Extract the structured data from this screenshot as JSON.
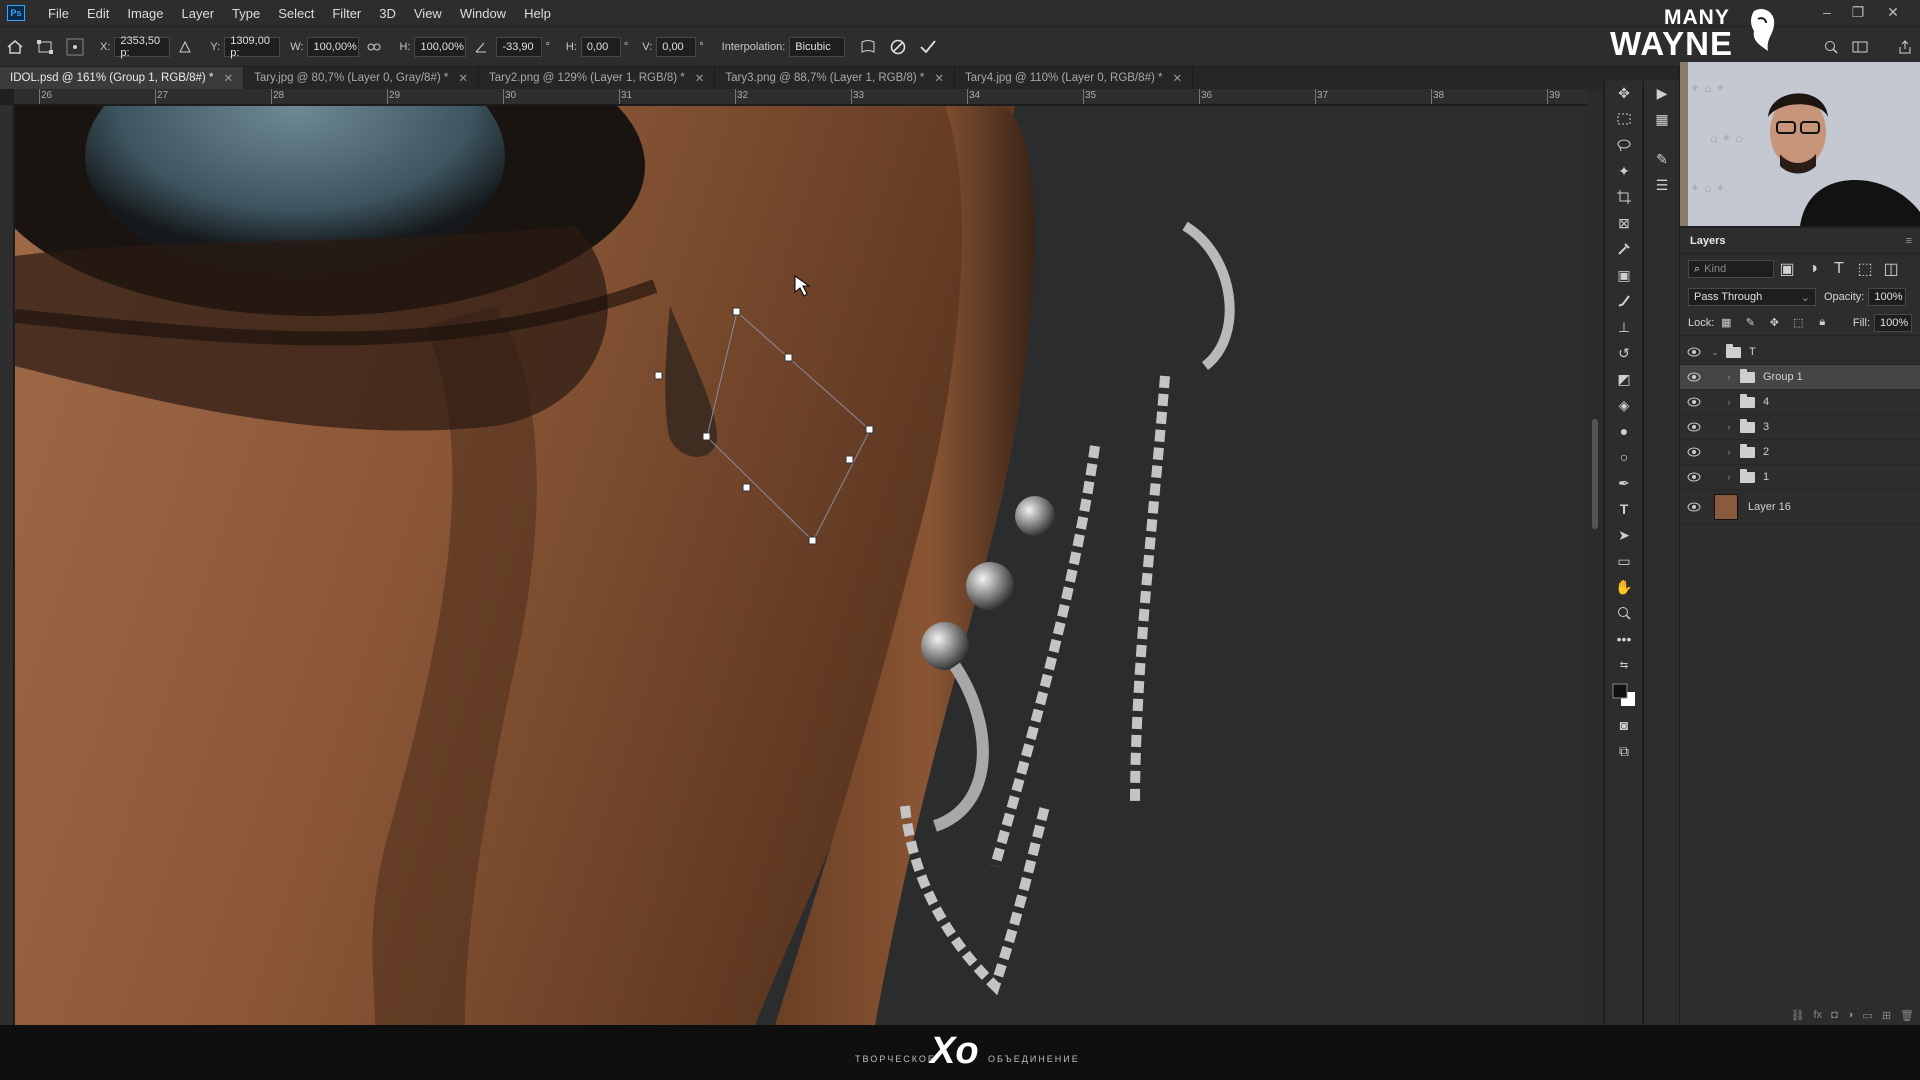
{
  "menubar": {
    "app_icon": "Ps",
    "items": [
      "File",
      "Edit",
      "Image",
      "Layer",
      "Type",
      "Select",
      "Filter",
      "3D",
      "View",
      "Window",
      "Help"
    ]
  },
  "brand": {
    "line1": "MANY",
    "line2": "WAYNE"
  },
  "options_bar": {
    "x_label": "X:",
    "x_value": "2353,50 p:",
    "y_label": "Y:",
    "y_value": "1309,00 p:",
    "w_label": "W:",
    "w_value": "100,00%",
    "h_label": "H:",
    "h_value": "100,00%",
    "angle_value": "-33,90",
    "angle_unit": "°",
    "hskew_label": "H:",
    "hskew_value": "0,00",
    "hskew_unit": "°",
    "vskew_label": "V:",
    "vskew_value": "0,00",
    "vskew_unit": "°",
    "interp_label": "Interpolation:",
    "interp_value": "Bicubic"
  },
  "tabs": [
    {
      "label": "IDOL.psd @ 161% (Group 1, RGB/8#) *",
      "active": true
    },
    {
      "label": "Tary.jpg @ 80,7% (Layer 0, Gray/8#) *",
      "active": false
    },
    {
      "label": "Tary2.png @ 129% (Layer 1, RGB/8) *",
      "active": false
    },
    {
      "label": "Tary3.png @ 88,7% (Layer 1, RGB/8) *",
      "active": false
    },
    {
      "label": "Tary4.jpg @ 110% (Layer 0, RGB/8#) *",
      "active": false
    }
  ],
  "ruler": {
    "labels": [
      "26",
      "27",
      "28",
      "29",
      "30",
      "31",
      "32",
      "33",
      "34",
      "35",
      "36",
      "37",
      "38",
      "39"
    ]
  },
  "layers_panel": {
    "title": "Layers",
    "search_placeholder": "Kind",
    "blend_mode": "Pass Through",
    "opacity_label": "Opacity:",
    "opacity_value": "100%",
    "lock_label": "Lock:",
    "fill_label": "Fill:",
    "fill_value": "100%",
    "layers": [
      {
        "name": "T",
        "type": "group",
        "expanded": true,
        "indent": 0,
        "selected": false
      },
      {
        "name": "Group 1",
        "type": "group",
        "indent": 1,
        "selected": true
      },
      {
        "name": "4",
        "type": "group",
        "indent": 1,
        "selected": false
      },
      {
        "name": "3",
        "type": "group",
        "indent": 1,
        "selected": false
      },
      {
        "name": "2",
        "type": "group",
        "indent": 1,
        "selected": false
      },
      {
        "name": "1",
        "type": "group",
        "indent": 1,
        "selected": false
      },
      {
        "name": "Layer 16",
        "type": "image",
        "indent": 0,
        "selected": false
      }
    ]
  },
  "footer": {
    "left_text": "ТВОРЧЕСКОЕ",
    "logo": "Xo",
    "right_text": "ОБЪЕДИНЕНИЕ"
  },
  "colors": {
    "accent": "#31a8ff",
    "panel": "#2d2d2d",
    "background": "#1f1f1f"
  }
}
